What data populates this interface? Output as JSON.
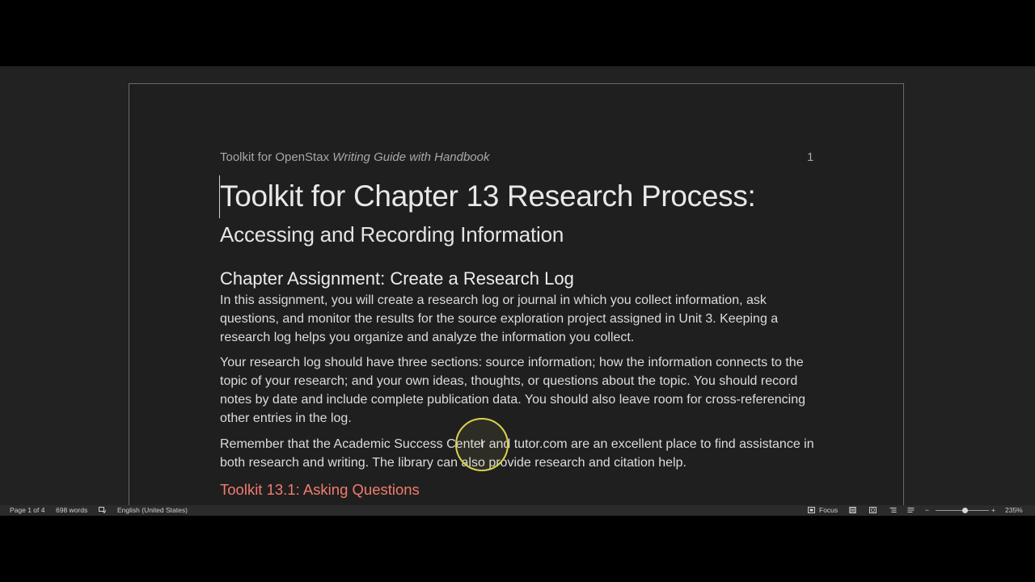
{
  "document": {
    "header_text_plain": "Toolkit for OpenStax ",
    "header_text_italic": "Writing Guide with Handbook",
    "page_number": "1",
    "title": "Toolkit for Chapter 13 Research Process:",
    "subtitle": "Accessing and Recording Information",
    "section_heading": "Chapter Assignment: Create a Research Log",
    "paragraphs": [
      "In this assignment, you will create a research log or journal in which you collect information, ask questions, and monitor the results for the source exploration project assigned in Unit 3. Keeping a research log helps you organize and analyze the information you collect.",
      "Your research log should have three sections: source information; how the information connects to the topic of your research; and your own ideas, thoughts, or questions about the topic. You should record notes by date and include complete publication data. You should also leave room for cross-referencing other entries in the log.",
      "Remember that the Academic Success Center and tutor.com are an excellent place to find assistance in both research and writing. The library can also provide research and citation help."
    ],
    "subsection_heading": "Toolkit 13.1: Asking Questions",
    "subsection_heading_color": "#f07c6e"
  },
  "status_bar": {
    "page_info": "Page 1 of 4",
    "word_count": "698 words",
    "language": "English (United States)",
    "focus_label": "Focus",
    "zoom_level": "235%",
    "zoom_fraction": 0.55
  },
  "icons": {
    "proofing": "proofing-icon",
    "focus": "focus-icon",
    "print_layout": "print-layout-icon",
    "web_layout": "web-layout-icon",
    "outline": "outline-icon",
    "draft": "draft-icon",
    "zoom_out": "zoom-out-icon",
    "zoom_in": "zoom-in-icon"
  },
  "colors": {
    "background": "#222222",
    "page": "#1f1f1f",
    "cursor_highlight": "#d9d34a"
  }
}
